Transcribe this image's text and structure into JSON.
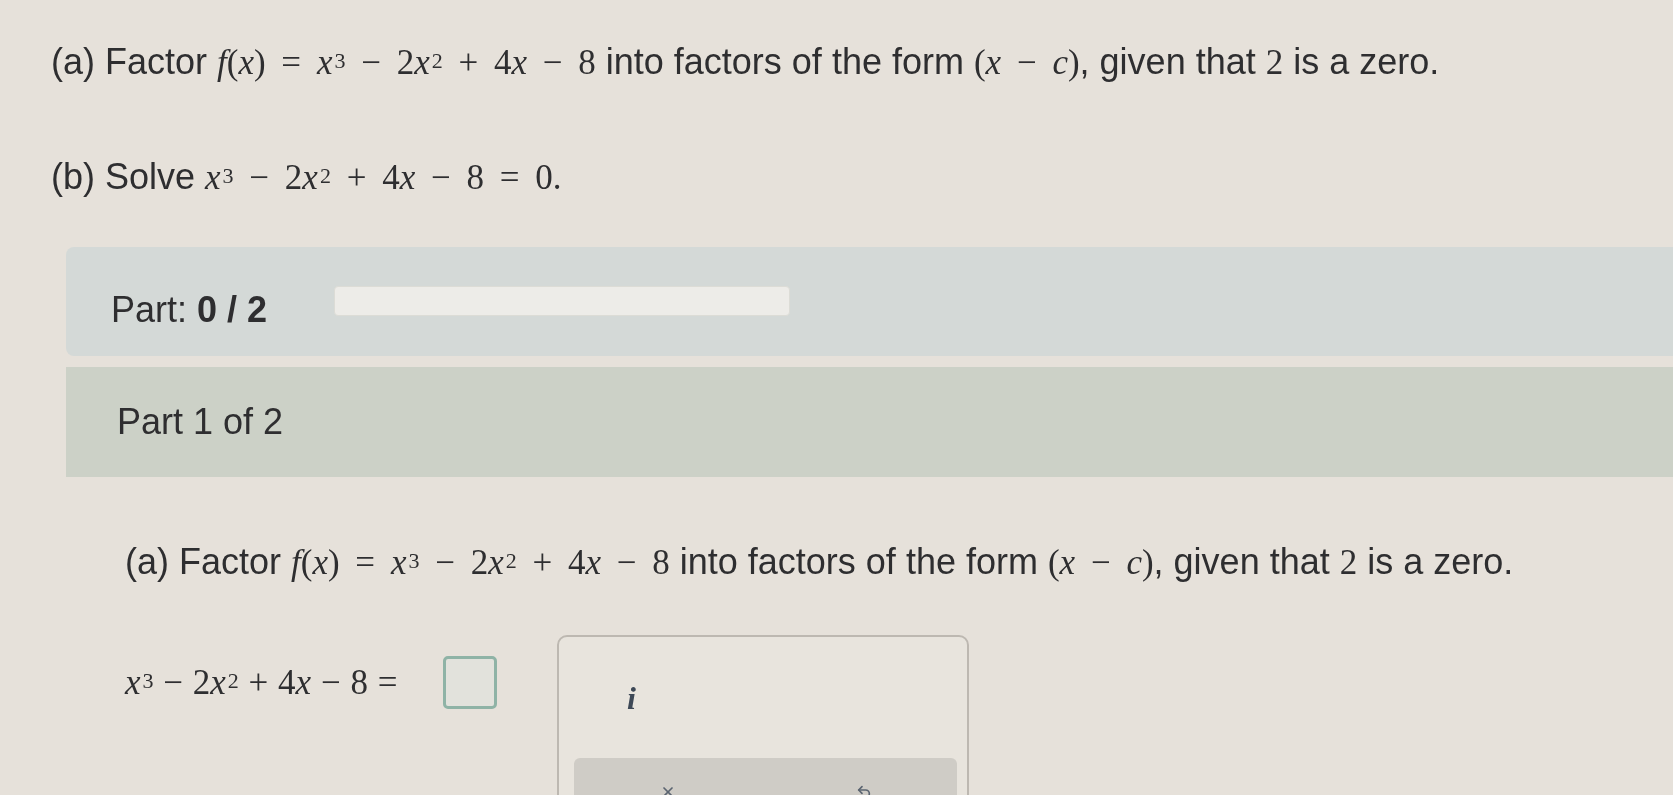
{
  "questions": [
    {
      "segments": [
        {
          "kind": "text",
          "text": "(a) Factor "
        },
        {
          "kind": "math",
          "text": "*f*(*x*) = *x*$^{3}$ − 2"
        },
        {
          "kind": "math",
          "text": "*x*$^{2}$ + 4"
        },
        {
          "kind": "math",
          "text": "*x* − 8"
        },
        {
          "kind": "text",
          "text": " into factors of the form "
        },
        {
          "kind": "math",
          "text": "(*x* − *c*)"
        },
        {
          "kind": "text",
          "text": ", given that "
        },
        {
          "kind": "math",
          "text": "2"
        },
        {
          "kind": "text",
          "text": " is a zero."
        }
      ]
    },
    {
      "segments": [
        {
          "kind": "text",
          "text": "(b) Solve "
        },
        {
          "kind": "math",
          "text": "*x*$^{3}$ − 2"
        },
        {
          "kind": "math",
          "text": "*x*$^{2}$ + 4"
        },
        {
          "kind": "math",
          "text": "*x* − 8 = 0."
        }
      ]
    }
  ],
  "progress": {
    "label": "Part: **0 / 2**",
    "level": 0
  },
  "part_header": {
    "title": "Part 1 of 2"
  },
  "part_question": {
    "segments": [
      {
        "kind": "text",
        "text": "(a) Factor "
      },
      {
        "kind": "math",
        "text": "*f*(*x*) = *x*$^{3}$ − 2"
      },
      {
        "kind": "math",
        "text": "*x*$^{2}$ + 4"
      },
      {
        "kind": "math",
        "text": "*x* − 8"
      },
      {
        "kind": "text",
        "text": " into factors of the form "
      },
      {
        "kind": "math",
        "text": "(*x* − *c*)"
      },
      {
        "kind": "text",
        "text": ", given that "
      },
      {
        "kind": "math",
        "text": "2"
      },
      {
        "kind": "text",
        "text": " is a zero."
      }
    ]
  },
  "answer": {
    "equation": [
      {
        "kind": "math",
        "text": "*x*$^{3}$ − 2"
      },
      {
        "kind": "math",
        "text": "*x*$^{2}$ + 4"
      },
      {
        "kind": "math",
        "text": "*x* − 8 ="
      }
    ]
  },
  "keypad": {
    "keys": [
      {
        "label": "i"
      }
    ]
  }
}
